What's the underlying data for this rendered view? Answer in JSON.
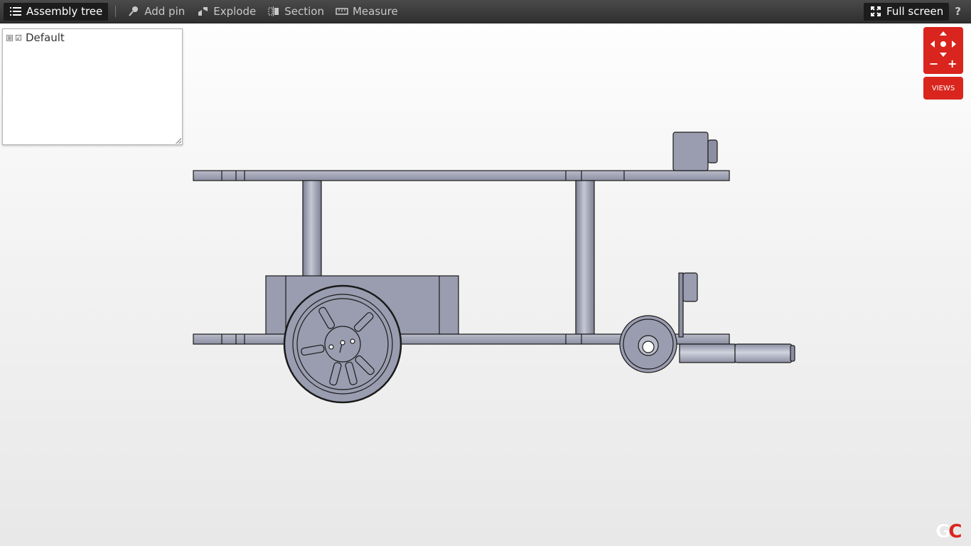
{
  "toolbar": {
    "assembly_tree": "Assembly tree",
    "add_pin": "Add pin",
    "explode": "Explode",
    "section": "Section",
    "measure": "Measure",
    "full_screen": "Full screen",
    "help": "?"
  },
  "tree": {
    "items": [
      {
        "label": "Default",
        "checked": true,
        "expander": "⊞"
      }
    ]
  },
  "nav": {
    "views_label": "VIEWS",
    "zoom_out": "−",
    "zoom_in": "+"
  },
  "colors": {
    "accent": "#d9251d",
    "toolbar": "#3a3a3a",
    "part_fill": "#9a9db0",
    "part_stroke": "#1a1a1a"
  }
}
